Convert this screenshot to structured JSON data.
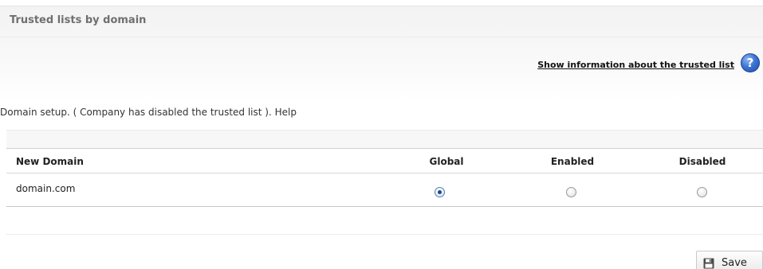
{
  "header": {
    "title": "Trusted lists by domain",
    "info_link": "Show information about the trusted list",
    "help_icon_glyph": "?"
  },
  "setup": {
    "text": "Domain setup. ( Company has disabled the trusted list ).",
    "help": "Help"
  },
  "table": {
    "columns": [
      "New Domain",
      "Global",
      "Enabled",
      "Disabled"
    ],
    "rows": [
      {
        "domain": "domain.com",
        "selected": "Global"
      }
    ]
  },
  "footer": {
    "save_label": "Save"
  },
  "icons": {
    "help": "help-icon",
    "save": "floppy-disk-icon",
    "radio": "radio-icon"
  },
  "colors": {
    "help_icon_blue": "#3f74d4",
    "radio_selected_dot": "#1d4a86",
    "title_text": "#6f6f6f"
  }
}
